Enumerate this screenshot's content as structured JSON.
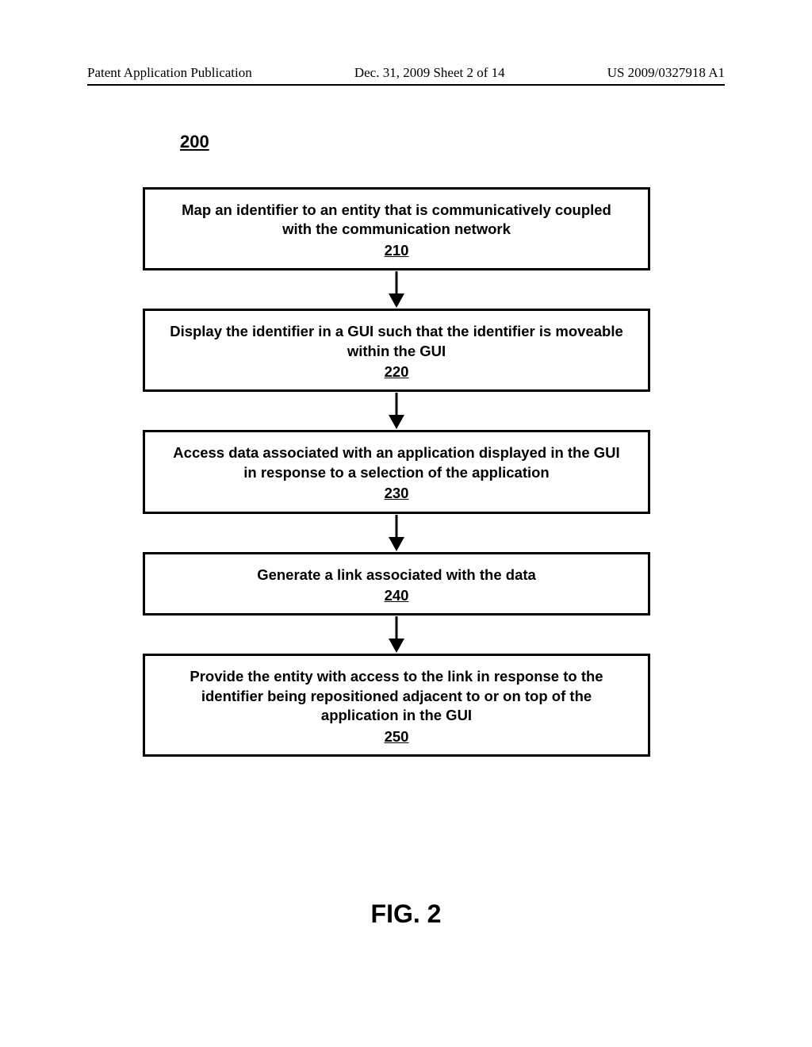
{
  "header": {
    "left": "Patent Application Publication",
    "center": "Dec. 31, 2009  Sheet 2 of 14",
    "right": "US 2009/0327918 A1"
  },
  "figure_ref": "200",
  "flowchart": {
    "steps": [
      {
        "text": "Map an identifier to an entity that is communicatively coupled with the communication network",
        "ref": "210"
      },
      {
        "text": "Display the identifier in a GUI such that the identifier is moveable within the GUI",
        "ref": "220"
      },
      {
        "text": "Access data associated with an application displayed in the GUI in response to a selection of the application",
        "ref": "230"
      },
      {
        "text": "Generate a link associated with the data",
        "ref": "240"
      },
      {
        "text": "Provide the entity with access to the link in response to the identifier being repositioned adjacent to or on top of the application in the GUI",
        "ref": "250"
      }
    ]
  },
  "figure_caption": "FIG. 2"
}
